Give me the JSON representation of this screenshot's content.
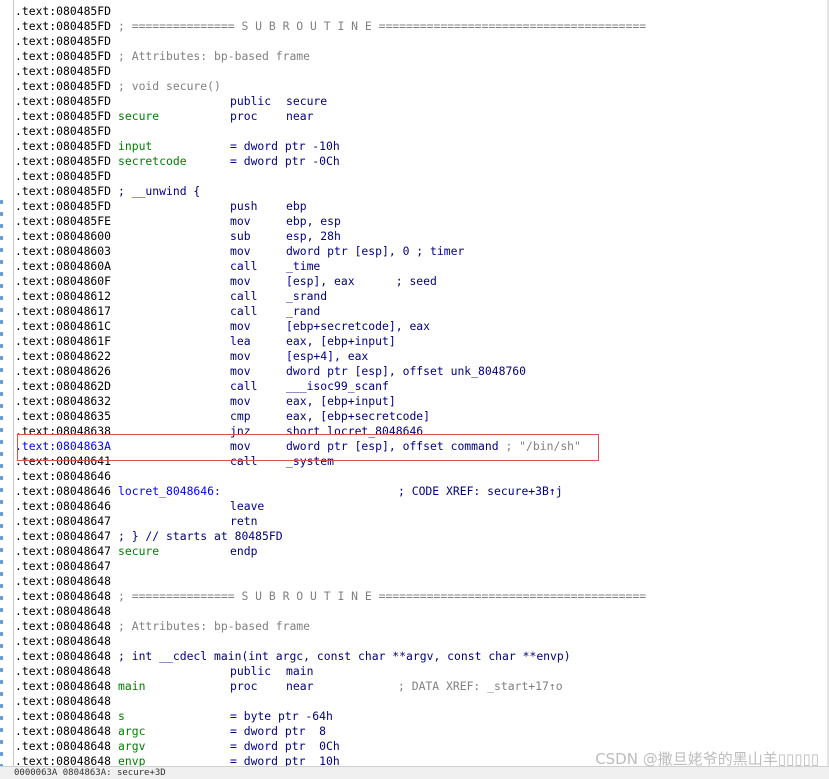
{
  "listing": [
    {
      "addr": ".text:080485FD"
    },
    {
      "addr": ".text:080485FD",
      "comment_full": "; =============== S U B R O U T I N E ======================================="
    },
    {
      "addr": ".text:080485FD"
    },
    {
      "addr": ".text:080485FD",
      "comment_full": "; Attributes: bp-based frame"
    },
    {
      "addr": ".text:080485FD"
    },
    {
      "addr": ".text:080485FD",
      "comment_full": "; void secure()"
    },
    {
      "addr": ".text:080485FD",
      "mnem": "public",
      "ops": "secure"
    },
    {
      "addr": ".text:080485FD",
      "name": "secure",
      "mnem": "proc",
      "ops": "near"
    },
    {
      "addr": ".text:080485FD"
    },
    {
      "addr": ".text:080485FD",
      "name": "input",
      "def": "= dword ptr -10h"
    },
    {
      "addr": ".text:080485FD",
      "name": "secretcode",
      "def": "= dword ptr -0Ch"
    },
    {
      "addr": ".text:080485FD"
    },
    {
      "addr": ".text:080485FD",
      "comment_blue": "; __unwind {"
    },
    {
      "addr": ".text:080485FD",
      "mnem": "push",
      "ops": "ebp"
    },
    {
      "addr": ".text:080485FE",
      "mnem": "mov",
      "ops": "ebp, esp"
    },
    {
      "addr": ".text:08048600",
      "mnem": "sub",
      "ops": "esp, 28h"
    },
    {
      "addr": ".text:08048603",
      "mnem": "mov",
      "ops": "dword ptr [esp], 0 ; timer"
    },
    {
      "addr": ".text:0804860A",
      "mnem": "call",
      "ops": "_time"
    },
    {
      "addr": ".text:0804860F",
      "mnem": "mov",
      "ops": "[esp], eax      ; seed"
    },
    {
      "addr": ".text:08048612",
      "mnem": "call",
      "ops": "_srand"
    },
    {
      "addr": ".text:08048617",
      "mnem": "call",
      "ops": "_rand"
    },
    {
      "addr": ".text:0804861C",
      "mnem": "mov",
      "ops": "[ebp+secretcode], eax"
    },
    {
      "addr": ".text:0804861F",
      "mnem": "lea",
      "ops": "eax, [ebp+input]"
    },
    {
      "addr": ".text:08048622",
      "mnem": "mov",
      "ops": "[esp+4], eax"
    },
    {
      "addr": ".text:08048626",
      "mnem": "mov",
      "ops": "dword ptr [esp], offset unk_8048760"
    },
    {
      "addr": ".text:0804862D",
      "mnem": "call",
      "ops": "___isoc99_scanf"
    },
    {
      "addr": ".text:08048632",
      "mnem": "mov",
      "ops": "eax, [ebp+input]"
    },
    {
      "addr": ".text:08048635",
      "mnem": "cmp",
      "ops": "eax, [ebp+secretcode]"
    },
    {
      "addr": ".text:08048638",
      "mnem": "jnz",
      "ops": "short locret_8048646"
    },
    {
      "addr": ".text:0804863A",
      "mnem": "mov",
      "ops": "dword ptr [esp], offset command",
      "tail": " ; \"/bin/sh\"",
      "highlight": true
    },
    {
      "addr": ".text:08048641",
      "mnem": "call",
      "ops": "_system"
    },
    {
      "addr": ".text:08048646"
    },
    {
      "addr": ".text:08048646",
      "label": "locret_8048646:",
      "xref": "; CODE XREF: secure+3B↑j"
    },
    {
      "addr": ".text:08048646",
      "mnem": "leave"
    },
    {
      "addr": ".text:08048647",
      "mnem": "retn"
    },
    {
      "addr": ".text:08048647",
      "comment_blue": "; } // starts at 80485FD"
    },
    {
      "addr": ".text:08048647",
      "name": "secure",
      "mnem": "endp"
    },
    {
      "addr": ".text:08048647"
    },
    {
      "addr": ".text:08048648"
    },
    {
      "addr": ".text:08048648",
      "comment_full": "; =============== S U B R O U T I N E ======================================="
    },
    {
      "addr": ".text:08048648"
    },
    {
      "addr": ".text:08048648",
      "comment_full": "; Attributes: bp-based frame"
    },
    {
      "addr": ".text:08048648"
    },
    {
      "addr": ".text:08048648",
      "comment_blue": "; int __cdecl main(int argc, const char **argv, const char **envp)"
    },
    {
      "addr": ".text:08048648",
      "mnem": "public",
      "ops": "main"
    },
    {
      "addr": ".text:08048648",
      "name": "main",
      "mnem": "proc",
      "ops": "near",
      "xref_grey": "; DATA XREF: _start+17↑o"
    },
    {
      "addr": ".text:08048648"
    },
    {
      "addr": ".text:08048648",
      "name": "s",
      "def": "= byte ptr -64h"
    },
    {
      "addr": ".text:08048648",
      "name": "argc",
      "def": "= dword ptr  8"
    },
    {
      "addr": ".text:08048648",
      "name": "argv",
      "def": "= dword ptr  0Ch"
    },
    {
      "addr": ".text:08048648",
      "name": "envp",
      "def": "= dword ptr  10h"
    }
  ],
  "status_bar": "0000063A 0804863A: secure+3D",
  "watermark": "CSDN @撒旦姥爷的黑山羊▯▯▯▯▯",
  "colors": {
    "address_highlight": "#0000ff",
    "selection_border": "#d9534f",
    "name": "#008000",
    "instruction": "#000080",
    "comment": "#808080"
  }
}
